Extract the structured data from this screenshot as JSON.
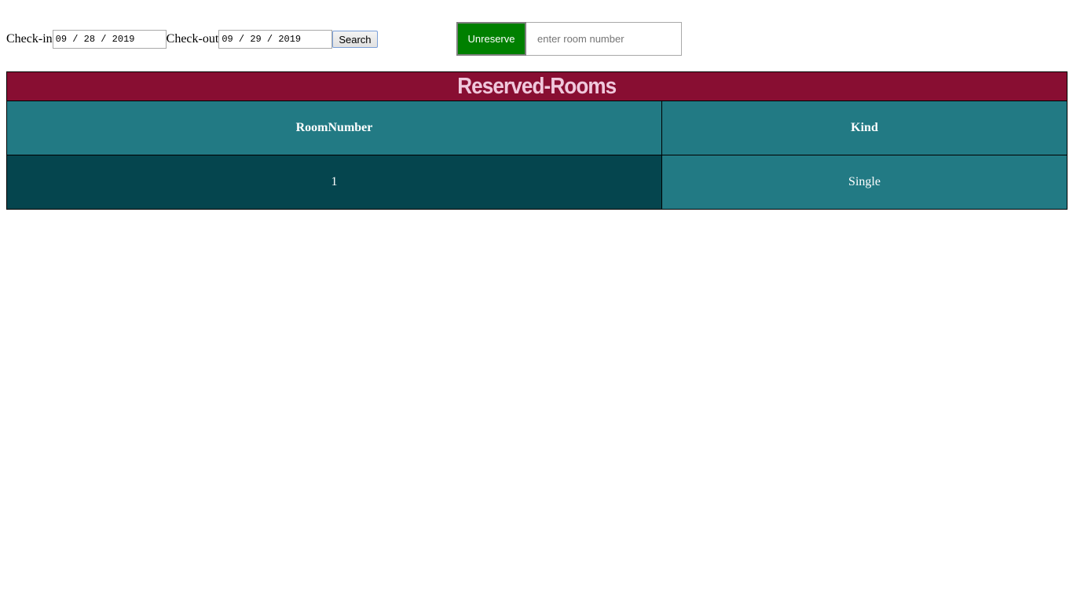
{
  "search_form": {
    "checkin_label": "Check-in",
    "checkin_value": "09 / 28 / 2019",
    "checkout_label": "Check-out",
    "checkout_value": "09 / 29 / 2019",
    "search_label": "Search"
  },
  "unreserve_form": {
    "button_label": "Unreserve",
    "room_placeholder": "enter room number"
  },
  "table": {
    "title": "Reserved-Rooms",
    "columns": [
      "RoomNumber",
      "Kind"
    ],
    "rows": [
      {
        "room_number": "1",
        "kind": "Single"
      }
    ]
  },
  "colors": {
    "title_bar": "#880e32",
    "title_text": "#f0c8dc",
    "header_bg": "#227a84",
    "row_dark": "#05454e",
    "row_light": "#227a84",
    "unreserve_button": "#008000"
  }
}
